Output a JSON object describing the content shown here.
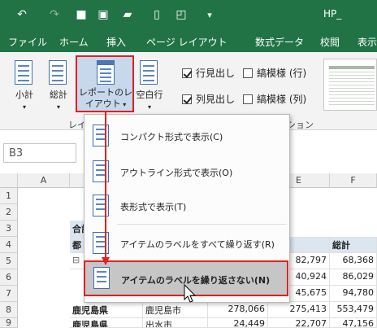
{
  "window": {
    "title": "HP_"
  },
  "quick_access": [
    {
      "icon": "undo-icon",
      "glyph": "↶"
    },
    {
      "icon": "redo-icon",
      "glyph": "↷"
    },
    {
      "icon": "save-icon",
      "glyph": "■"
    },
    {
      "icon": "touch-mode-icon",
      "glyph": "▣"
    },
    {
      "icon": "open-folder-icon",
      "glyph": "▰"
    },
    {
      "icon": "new-document-icon",
      "glyph": "▯"
    },
    {
      "icon": "print-preview-icon",
      "glyph": "◰"
    },
    {
      "icon": "customize-qat-icon",
      "glyph": "▾"
    }
  ],
  "tabs": [
    "ファイル",
    "ホーム",
    "挿入",
    "ページ レイアウト",
    "数式",
    "データ",
    "校閲",
    "表示"
  ],
  "ribbon": {
    "subtotal": "小計",
    "grand_total": "総計",
    "report_layout_line1": "レポートのレ",
    "report_layout_line2": "イアウト",
    "blank_rows": "空白行",
    "row_headers": "行見出し",
    "banded_rows": "縞模様 (行)",
    "column_headers": "列見出し",
    "banded_columns": "縞模様 (列)",
    "group_layout": "レイ",
    "group_options": "ション"
  },
  "name_box": "B3",
  "columns": [
    "A",
    "E",
    "F"
  ],
  "rows": [
    "1",
    "2",
    "3",
    "4",
    "5",
    "6",
    "7",
    "8",
    "9"
  ],
  "sheet": {
    "b3": "合計",
    "b4": "都",
    "f4": "総計",
    "collapse": "⊟",
    "r5": [
      "82,797",
      "68,368"
    ],
    "r6": [
      "40,924",
      "86,029"
    ],
    "r7": [
      "45,675",
      "94,780"
    ],
    "r8": [
      "鹿児島県",
      "鹿児島市",
      "278,066",
      "275,413",
      "553,479"
    ],
    "r9": [
      "鹿児島県",
      "出水市",
      "24,449",
      "22,707",
      "47,156"
    ]
  },
  "menu": {
    "items": [
      "コンパクト形式で表示(C)",
      "アウトライン形式で表示(O)",
      "表形式で表示(T)",
      "アイテムのラベルをすべて繰り返す(R)",
      "アイテムのラベルを繰り返さない(N)"
    ]
  }
}
